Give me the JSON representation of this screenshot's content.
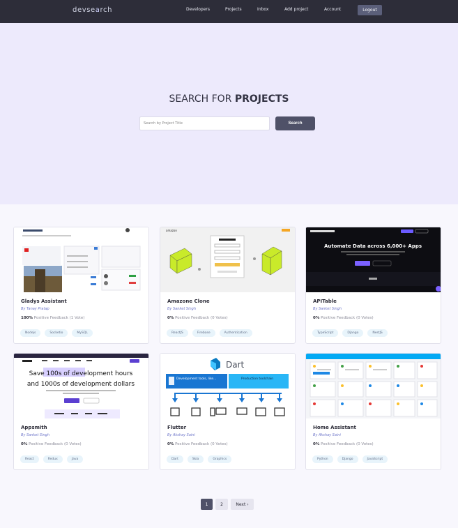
{
  "brand": {
    "prefix": "devse",
    "accent": "a",
    "suffix": "rch"
  },
  "nav": {
    "developers": "Developers",
    "projects": "Projects",
    "inbox": "Inbox",
    "add_project": "Add project",
    "account": "Account",
    "logout": "Logout"
  },
  "hero": {
    "title_light": "SEARCH FOR",
    "title_bold": "PROJECTS",
    "placeholder": "Search by Project Title",
    "button": "Search"
  },
  "projects": [
    {
      "title": "Gladys Assistant",
      "author": "By Tanay Pratap",
      "percent": "100%",
      "feedback": "Positive Feedback (1 Vote)",
      "tags": [
        "Nodejs",
        "Socketio",
        "MySQL"
      ]
    },
    {
      "title": "Amazone Clone",
      "author": "By Sanket Singh",
      "percent": "0%",
      "feedback": "Positive Feedback (0 Votes)",
      "tags": [
        "ReactJS",
        "Firebase",
        "Authentication"
      ]
    },
    {
      "title": "APITable",
      "author": "By Sanket Singh",
      "percent": "0%",
      "feedback": "Positive Feedback (0 Votes)",
      "tags": [
        "TypeScript",
        "Django",
        "NestJS"
      ]
    },
    {
      "title": "Appsmith",
      "author": "By Sanket Singh",
      "percent": "0%",
      "feedback": "Positive Feedback (0 Votes)",
      "tags": [
        "React",
        "Redux",
        "Java"
      ]
    },
    {
      "title": "Flutter",
      "author": "By Akshay Saini",
      "percent": "0%",
      "feedback": "Positive Feedback (0 Votes)",
      "tags": [
        "Dart",
        "Skia",
        "Graphics"
      ]
    },
    {
      "title": "Home Assistant",
      "author": "By Akshay Saini",
      "percent": "0%",
      "feedback": "Positive Feedback (0 Votes)",
      "tags": [
        "Python",
        "Django",
        "JavaScript"
      ]
    }
  ],
  "thumbs": {
    "apitable_headline": "Automate Data across 6,000+ Apps",
    "appsmith_line1": "Save 100s of development hours",
    "appsmith_line2": "and 1000s of development dollars",
    "flutter_logo_text": "Dart",
    "flutter_box1": "Development tools, like...",
    "flutter_box2": "Production toolchain",
    "amazon_logo": "amazon"
  },
  "pagination": {
    "page1": "1",
    "page2": "2",
    "next": "Next ›"
  }
}
